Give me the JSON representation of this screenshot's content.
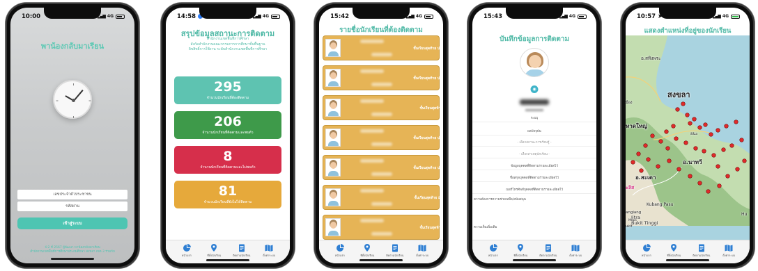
{
  "screens": {
    "login": {
      "time": "10:00",
      "network": "4G",
      "title": "พาน้องกลับมาเรียน",
      "username_placeholder": "เลขประจำตัวประชาชน",
      "password_placeholder": "รหัสผ่าน",
      "login_button": "เข้าสู่ระบบ",
      "footer_line1": "©2 ที่ 2567 ผู้พัฒนา พาน้องกลับมาเรียน",
      "footer_line2": "สำนักงานเขตพื้นที่การศึกษาประถมศึกษา สงขลา เขต 3 ร่วมกับ"
    },
    "summary": {
      "time": "14:58",
      "network": "4G",
      "title": "สรุปข้อมูลสถานะการติดตาม",
      "sub_line1": "สำนักงานเขตพื้นที่การศึกษา",
      "sub_line2": "สังกัดสำนักงานคณะกรรมการการศึกษาขั้นพื้นฐาน",
      "sub_line3": "ลิขสิทธิ์การใช้งาน ระดับสำนักงานเขตพื้นที่การศึกษา",
      "cards": [
        {
          "value": "295",
          "label": "จำนวนนักเรียนที่ต้องติดตาม",
          "color": "#5ec3b1"
        },
        {
          "value": "206",
          "label": "จำนวนนักเรียนที่ติดตามและพบตัว",
          "color": "#3e9a4a"
        },
        {
          "value": "8",
          "label": "จำนวนนักเรียนที่ติดตามและไม่พบตัว",
          "color": "#d62f4b"
        },
        {
          "value": "81",
          "label": "จำนวนนักเรียนที่ยังไม่ได้ติดตาม",
          "color": "#e6a93b"
        }
      ]
    },
    "list": {
      "time": "15:42",
      "network": "4G",
      "title": "รายชื่อนักเรียนที่ต้องติดตาม",
      "students": [
        {
          "class": "ชั้นเรียนสุดท้าย ประถมศึกษาปีที่ 5"
        },
        {
          "class": "ชั้นเรียนสุดท้าย ประถมศึกษาปีที่ 6"
        },
        {
          "class": "ชั้นเรียนสุดท้าย อนุบาล 3"
        },
        {
          "class": "ชั้นเรียนสุดท้าย ประถมศึกษาปีที่ 4"
        },
        {
          "class": "ชั้นเรียนสุดท้าย ประถมศึกษาปีที่ 5"
        },
        {
          "class": "ชั้นเรียนสุดท้าย มัธยมศึกษาปีที่ 2"
        },
        {
          "class": "ชั้นเรียนสุดท้าย อนุบาล 1"
        }
      ]
    },
    "record": {
      "time": "15:43",
      "network": "4G",
      "title": "บันทึกข้อมูลการติดตาม",
      "field_school": "ระบบุ",
      "field_status": "ผลปัจจุบัน",
      "option_1": "- เลือกสถานะการเรียนรู้ -",
      "option_2": "- เลือกสาเหตุนักเรียน -",
      "option_3": "ข้อมูลบุคคลที่ติดตามรายละเอียดไว้",
      "option_4": "ชื่อสกุลบุคคลที่ติดตามรายละเอียดไว้",
      "option_5": "เบอร์โทรศัพท์บุคคลที่ติดตามรายละเอียดไว้",
      "label_notes": "ความต้องการความช่วยเหลือ/สนับสนุน",
      "label_more": "ความเห็นเพิ่มเติม"
    },
    "map": {
      "time": "10:57",
      "network": "4G",
      "title": "แสดงตำแหน่งที่อยู่ของนักเรียน",
      "labels": [
        "อ.สทิงพระ",
        "สงขลา",
        "หาดใหญ่",
        "อ.นาทวี",
        "อ.สะเดา",
        "Kubang Pasu",
        "Jitra",
        "Bukit Tinggi",
        "Hu",
        "ยนะ",
        "มือง",
        "ะลิส",
        "angiang",
        "ukit",
        "Maps"
      ]
    }
  },
  "tabs": [
    {
      "label": "หน้าแรก",
      "icon": "pie-chart-icon"
    },
    {
      "label": "ที่ตั้งนักเรียน",
      "icon": "location-pin-icon"
    },
    {
      "label": "ติดตามนักเรียน",
      "icon": "document-icon"
    },
    {
      "label": "ตั้งค่าระบบ",
      "icon": "map-icon"
    }
  ]
}
